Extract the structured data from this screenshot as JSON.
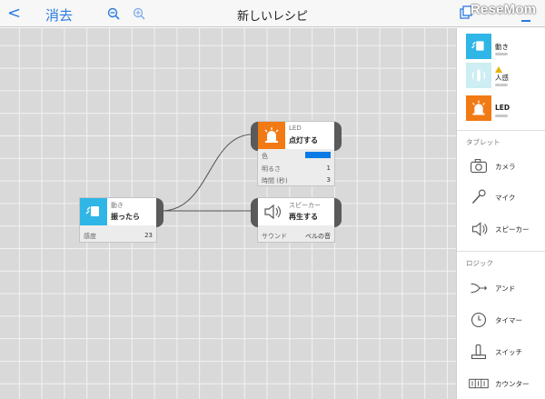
{
  "header": {
    "back_symbol": "<",
    "delete_label": "消去",
    "title": "新しいレシピ",
    "watermark": "ReseMom"
  },
  "nodes": {
    "motion": {
      "category": "動き",
      "name": "振ったら",
      "rows": [
        {
          "label": "感度",
          "value": "23"
        }
      ]
    },
    "led": {
      "category": "LED",
      "name": "点灯する",
      "rows": [
        {
          "label": "色",
          "value": ""
        },
        {
          "label": "明るさ",
          "value": "1"
        },
        {
          "label": "時間 (秒)",
          "value": "3"
        }
      ],
      "color_swatch": "#0a7be6"
    },
    "speaker": {
      "category": "スピーカー",
      "name": "再生する",
      "rows": [
        {
          "label": "サウンド",
          "value": "ベルの音"
        }
      ]
    }
  },
  "sidebar": {
    "items_top": [
      {
        "label": "動き",
        "color": "#2fb6e6",
        "icon": "motion-icon"
      },
      {
        "label": "人感",
        "color": "#cdeef2",
        "icon": "human-sensor-icon",
        "badge": "?"
      },
      {
        "label": "LED",
        "color": "#f27a14",
        "icon": "led-alarm-icon"
      }
    ],
    "tablet_header": "タブレット",
    "tablet_items": [
      {
        "label": "カメラ",
        "icon": "camera-icon"
      },
      {
        "label": "マイク",
        "icon": "microphone-icon"
      },
      {
        "label": "スピーカー",
        "icon": "speaker-icon"
      }
    ],
    "logic_header": "ロジック",
    "logic_items": [
      {
        "label": "アンド",
        "icon": "and-logic-icon"
      },
      {
        "label": "タイマー",
        "icon": "timer-icon"
      },
      {
        "label": "スイッチ",
        "icon": "switch-icon"
      },
      {
        "label": "カウンター",
        "icon": "counter-icon"
      }
    ]
  },
  "colors": {
    "accent": "#2a7ae2",
    "motion": "#2fb6e6",
    "led": "#f27a14",
    "port": "#5a5a5a"
  }
}
